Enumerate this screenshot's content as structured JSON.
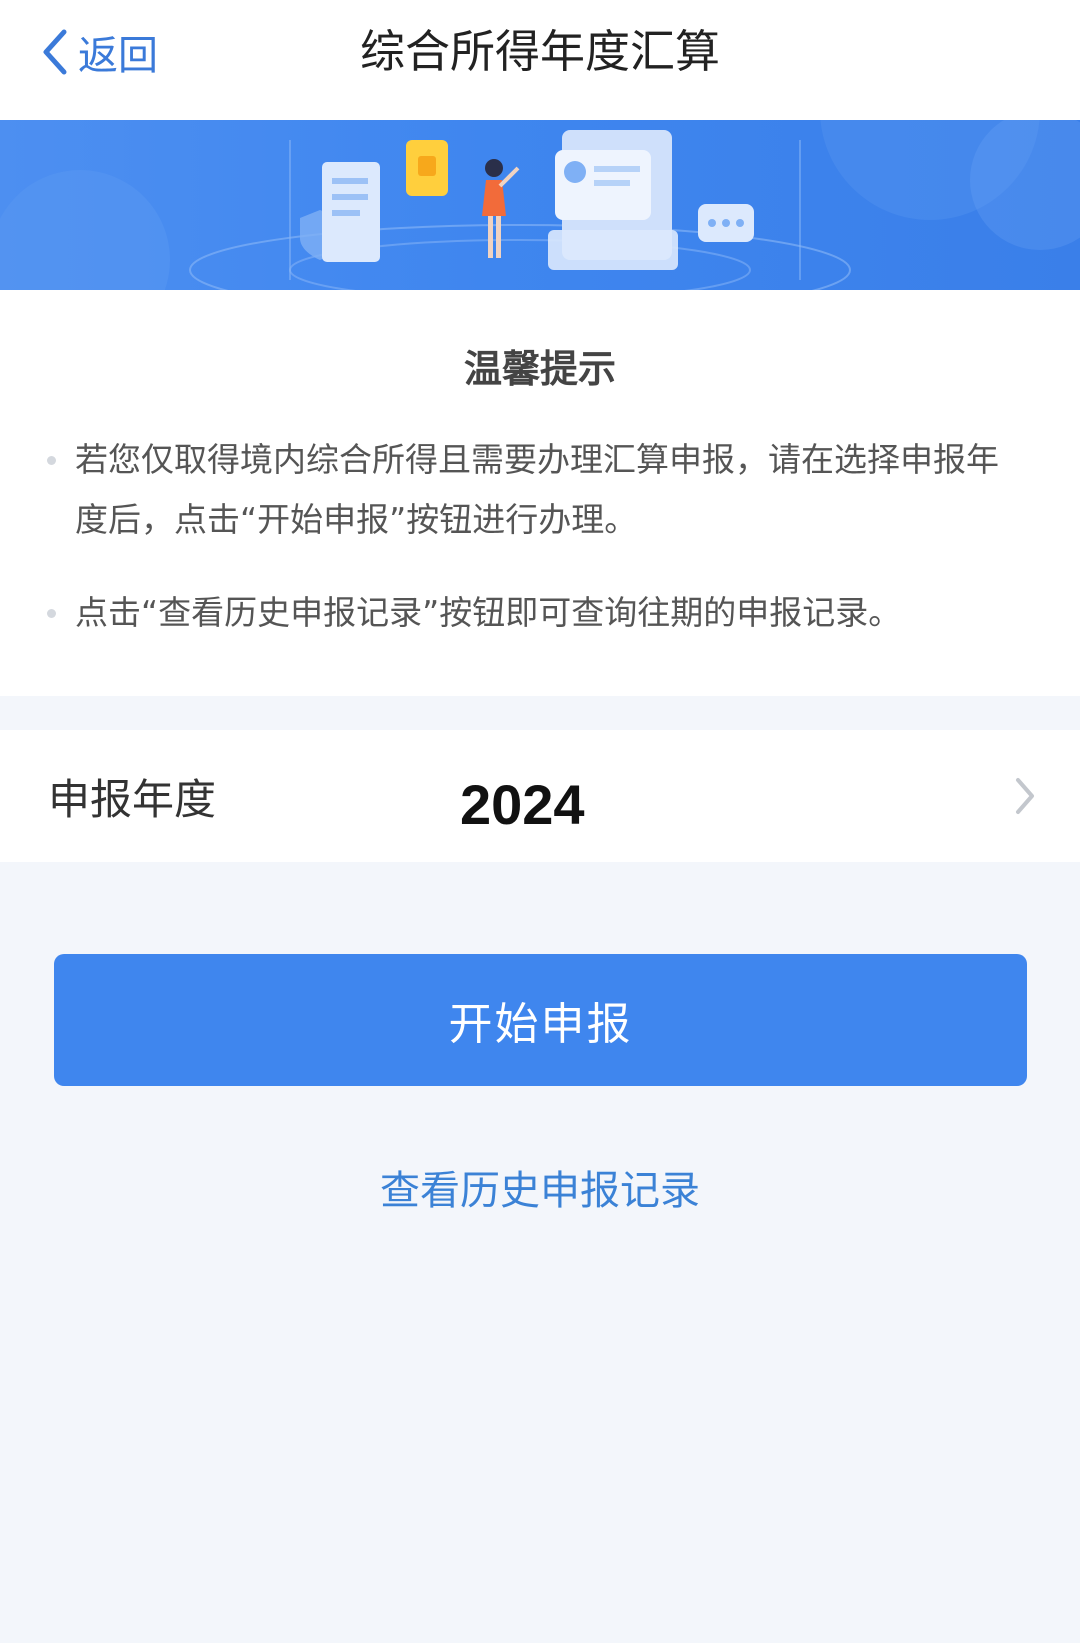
{
  "nav": {
    "back_label": "返回",
    "title": "综合所得年度汇算"
  },
  "notice": {
    "title": "温馨提示",
    "tips": [
      "若您仅取得境内综合所得且需要办理汇算申报，请在选择申报年度后，点击“开始申报”按钮进行办理。",
      "点击“查看历史申报记录”按钮即可查询往期的申报记录。"
    ]
  },
  "year_selector": {
    "label": "申报年度",
    "value": "2024"
  },
  "actions": {
    "start_label": "开始申报",
    "history_label": "查看历史申报记录"
  },
  "colors": {
    "primary": "#3f86ee",
    "link": "#3b82d6",
    "page_bg": "#f3f6fb"
  }
}
